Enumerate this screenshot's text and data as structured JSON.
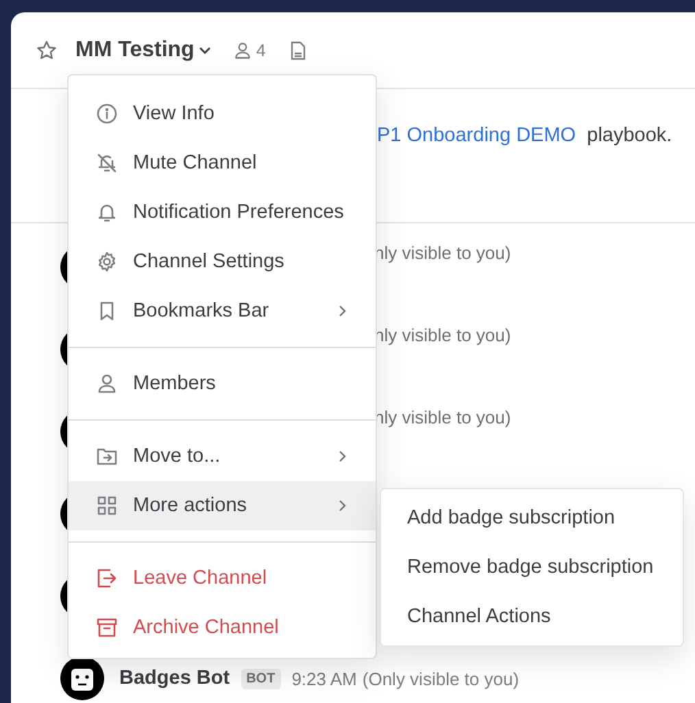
{
  "channel": {
    "title": "MM Testing",
    "favorited": false,
    "member_count": "4"
  },
  "intro": {
    "link": "P1 Onboarding DEMO",
    "text": "playbook."
  },
  "messages": [
    {
      "kind": "partial",
      "text": "nly visible to you)"
    },
    {
      "kind": "partial",
      "text": "nly visible to you)"
    },
    {
      "kind": "partial",
      "text": "nly visible to you)"
    },
    {
      "kind": "avatar_only"
    },
    {
      "kind": "avatar_only"
    },
    {
      "kind": "full",
      "author": "Badges Bot",
      "badge": "BOT",
      "time": "9:23 AM",
      "note": "(Only visible to you)"
    }
  ],
  "menu": {
    "sections": [
      [
        {
          "label": "View Info",
          "submenu": false,
          "selected": false,
          "danger": false
        },
        {
          "label": "Mute Channel",
          "submenu": false,
          "selected": false,
          "danger": false
        },
        {
          "label": "Notification Preferences",
          "submenu": false,
          "selected": false,
          "danger": false
        },
        {
          "label": "Channel Settings",
          "submenu": false,
          "selected": false,
          "danger": false
        },
        {
          "label": "Bookmarks Bar",
          "submenu": true,
          "selected": false,
          "danger": false
        }
      ],
      [
        {
          "label": "Members",
          "submenu": false,
          "selected": false,
          "danger": false
        }
      ],
      [
        {
          "label": "Move to...",
          "submenu": true,
          "selected": false,
          "danger": false
        },
        {
          "label": "More actions",
          "submenu": true,
          "selected": true,
          "danger": false
        }
      ],
      [
        {
          "label": "Leave Channel",
          "submenu": false,
          "selected": false,
          "danger": true
        },
        {
          "label": "Archive Channel",
          "submenu": false,
          "selected": false,
          "danger": true
        }
      ]
    ]
  },
  "submenu": {
    "items": [
      "Add badge subscription",
      "Remove badge subscription",
      "Channel Actions"
    ]
  }
}
